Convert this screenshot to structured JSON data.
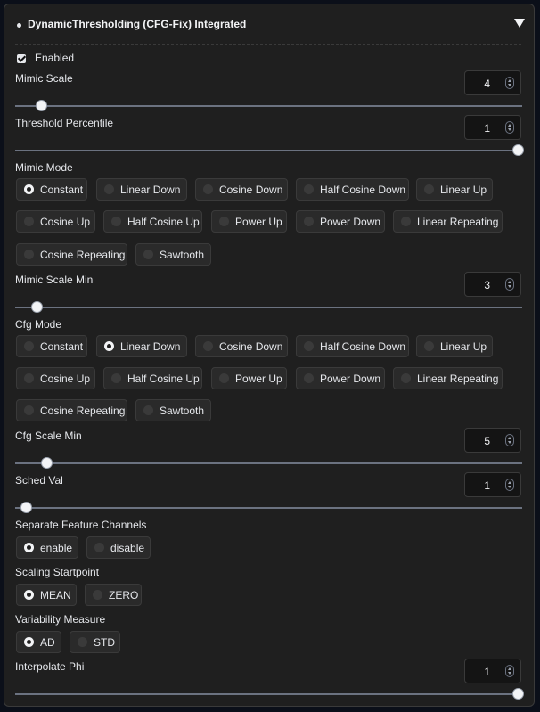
{
  "header": {
    "title": "DynamicThresholding (CFG-Fix) Integrated"
  },
  "enabled": {
    "label": "Enabled",
    "checked": true
  },
  "mimic_scale": {
    "label": "Mimic Scale",
    "value": "4",
    "min": 1,
    "max": 100,
    "position": 0.05
  },
  "threshold_percentile": {
    "label": "Threshold Percentile",
    "value": "1",
    "min": 0.9,
    "max": 1,
    "position": 1.0
  },
  "mimic_mode": {
    "label": "Mimic Mode",
    "selected": "Constant",
    "options": [
      "Constant",
      "Linear Down",
      "Cosine Down",
      "Half Cosine Down",
      "Linear Up",
      "Cosine Up",
      "Half Cosine Up",
      "Power Up",
      "Power Down",
      "Linear Repeating",
      "Cosine Repeating",
      "Sawtooth"
    ]
  },
  "mimic_scale_min": {
    "label": "Mimic Scale Min",
    "value": "3",
    "position": 0.03
  },
  "cfg_mode": {
    "label": "Cfg Mode",
    "selected": "Linear Down",
    "options": [
      "Constant",
      "Linear Down",
      "Cosine Down",
      "Half Cosine Down",
      "Linear Up",
      "Cosine Up",
      "Half Cosine Up",
      "Power Up",
      "Power Down",
      "Linear Repeating",
      "Cosine Repeating",
      "Sawtooth"
    ]
  },
  "cfg_scale_min": {
    "label": "Cfg Scale Min",
    "value": "5",
    "position": 0.05
  },
  "sched_val": {
    "label": "Sched Val",
    "value": "1",
    "position": 0.0
  },
  "separate_feature_channels": {
    "label": "Separate Feature Channels",
    "selected": "enable",
    "options": [
      "enable",
      "disable"
    ]
  },
  "scaling_startpoint": {
    "label": "Scaling Startpoint",
    "selected": "MEAN",
    "options": [
      "MEAN",
      "ZERO"
    ]
  },
  "variability_measure": {
    "label": "Variability Measure",
    "selected": "AD",
    "options": [
      "AD",
      "STD"
    ]
  },
  "interpolate_phi": {
    "label": "Interpolate Phi",
    "value": "1",
    "position": 1.0
  }
}
